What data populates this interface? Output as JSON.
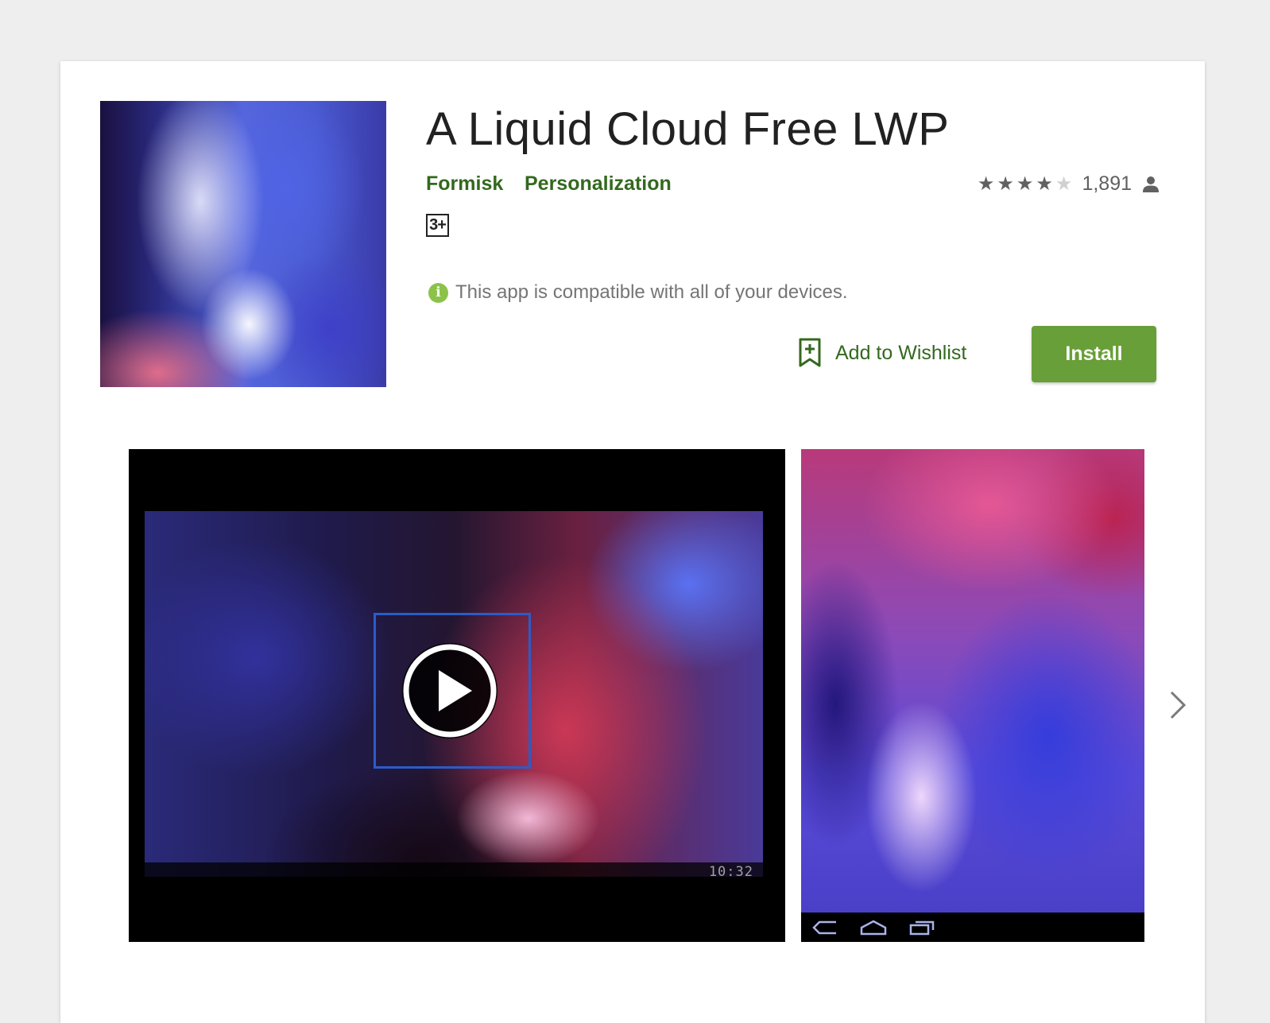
{
  "app": {
    "title": "A Liquid Cloud Free LWP",
    "developer": "Formisk",
    "category": "Personalization",
    "content_rating": "3+",
    "rating_stars": 4,
    "rating_max": 5,
    "rating_count": "1,891",
    "compatibility_message": "This app is compatible with all of your devices."
  },
  "actions": {
    "wishlist_label": "Add to Wishlist",
    "install_label": "Install"
  },
  "media": {
    "video_clock": "10:32"
  },
  "icons": {
    "star": "star-icon",
    "person": "person-icon",
    "info": "info-icon",
    "wishlist": "bookmark-add-icon",
    "play": "play-icon",
    "next": "chevron-right-icon",
    "nav_back": "back-icon",
    "nav_home": "home-icon",
    "nav_recent": "recent-apps-icon"
  },
  "colors": {
    "accent_green": "#33691e",
    "install_button": "#689f38",
    "info_badge": "#8bc34a",
    "star_filled": "#616161",
    "star_empty": "#d0d0d0"
  }
}
